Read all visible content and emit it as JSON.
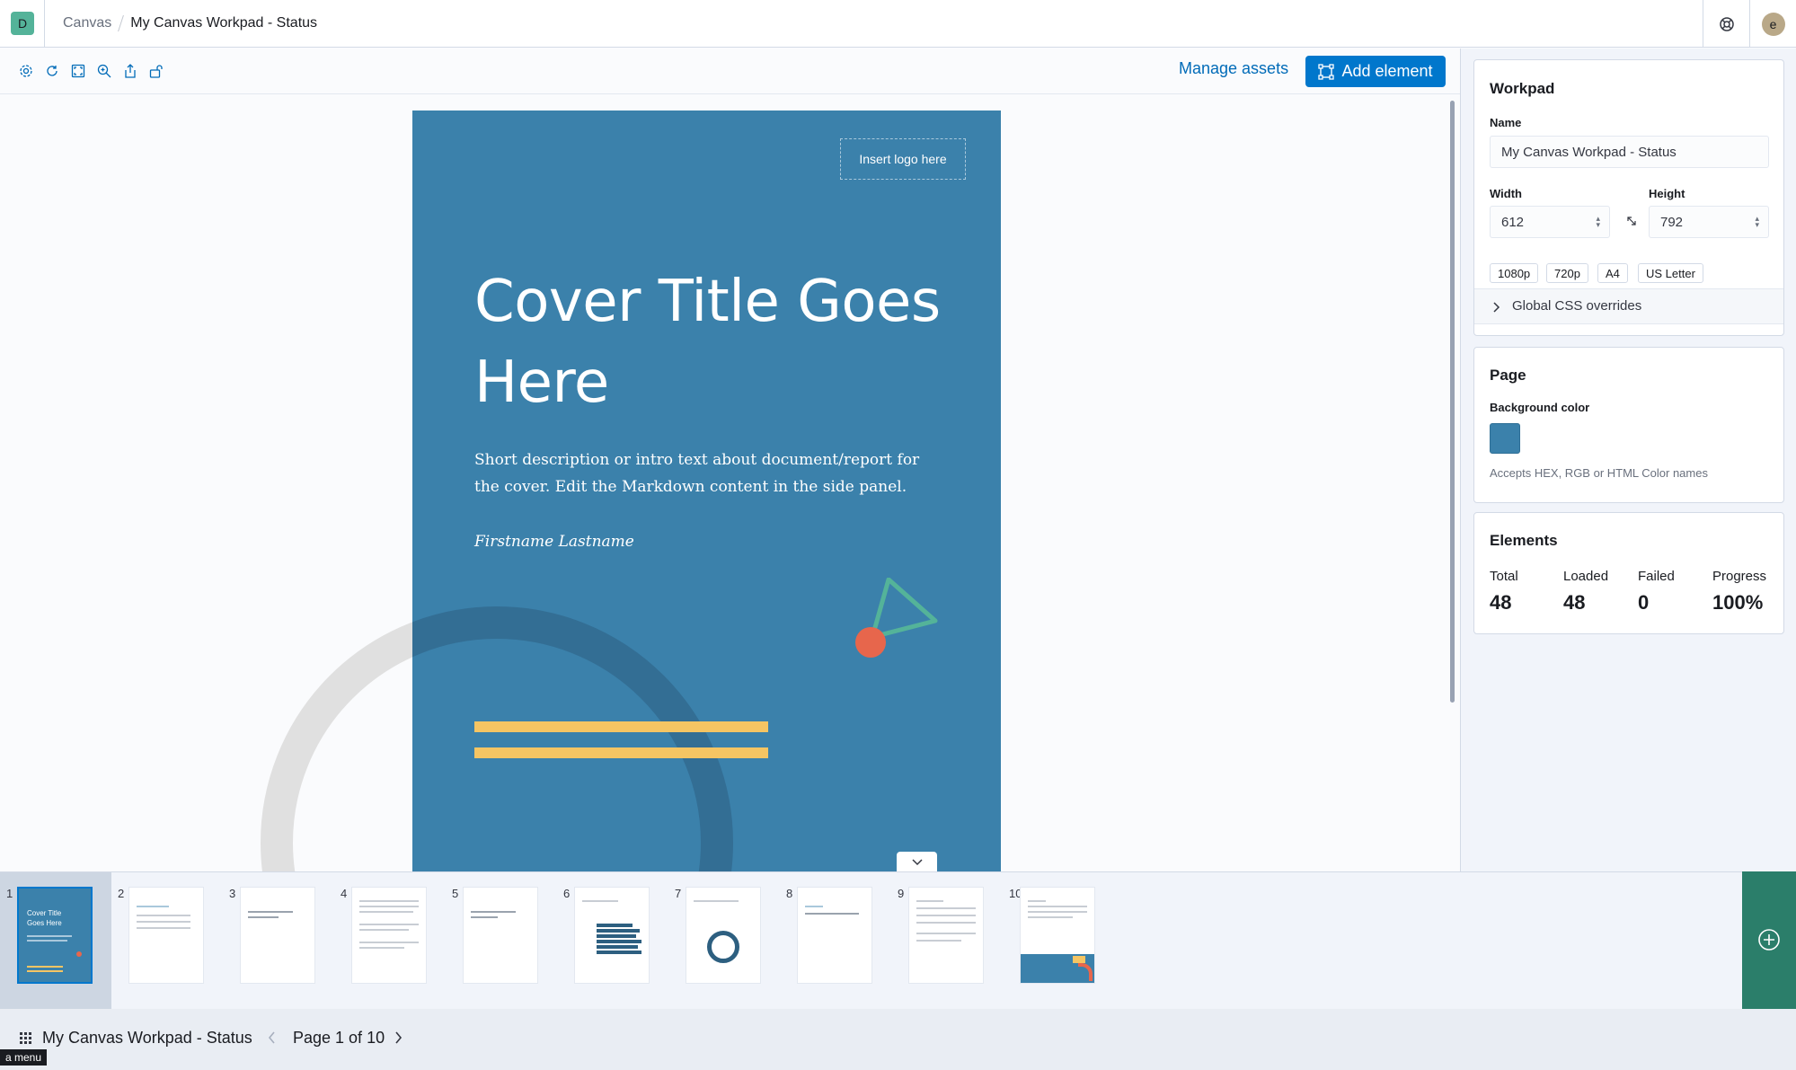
{
  "header": {
    "space_initial": "D",
    "breadcrumb_app": "Canvas",
    "breadcrumb_current": "My Canvas Workpad - Status",
    "user_initial": "e"
  },
  "toolbar": {
    "manage_assets_label": "Manage assets",
    "add_element_label": "Add element"
  },
  "page": {
    "logo_placeholder": "Insert logo here",
    "title": "Cover Title Goes Here",
    "description": "Short description or intro text about document/report for the cover. Edit the Markdown content in the side panel.",
    "author": "Firstname Lastname",
    "background_color": "#3b81ab"
  },
  "thumbnails": [
    {
      "number": "1",
      "selected": true
    },
    {
      "number": "2"
    },
    {
      "number": "3"
    },
    {
      "number": "4"
    },
    {
      "number": "5"
    },
    {
      "number": "6"
    },
    {
      "number": "7"
    },
    {
      "number": "8"
    },
    {
      "number": "9"
    },
    {
      "number": "10"
    }
  ],
  "footer": {
    "workpad_name": "My Canvas Workpad - Status",
    "page_indicator": "Page 1 of 10",
    "menu_tooltip": "a menu"
  },
  "sidebar": {
    "workpad": {
      "title": "Workpad",
      "name_label": "Name",
      "name_value": "My Canvas Workpad - Status",
      "width_label": "Width",
      "width_value": "612",
      "height_label": "Height",
      "height_value": "792",
      "presets": [
        "1080p",
        "720p",
        "A4",
        "US Letter"
      ],
      "css_overrides_label": "Global CSS overrides"
    },
    "page": {
      "title": "Page",
      "bg_label": "Background color",
      "bg_color": "#3b81ab",
      "bg_hint": "Accepts HEX, RGB or HTML Color names"
    },
    "elements": {
      "title": "Elements",
      "total_label": "Total",
      "total_value": "48",
      "loaded_label": "Loaded",
      "loaded_value": "48",
      "failed_label": "Failed",
      "failed_value": "0",
      "progress_label": "Progress",
      "progress_value": "100%"
    }
  }
}
